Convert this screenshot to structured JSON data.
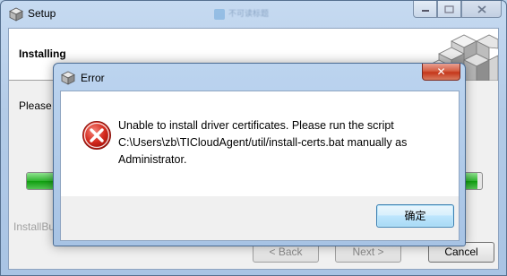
{
  "setup": {
    "title": "Setup",
    "taskbar_tab": "不可读标题",
    "header_title": "Installing",
    "body_text": "Please",
    "progress_fraction": 0.99,
    "brand_text": "InstallBu",
    "back_label": "< Back",
    "next_label": "Next >",
    "cancel_label": "Cancel"
  },
  "error": {
    "title": "Error",
    "close_label": "✕",
    "message_line1": "Unable to install driver certificates. Please run the script",
    "message_line2": "C:\\Users\\zb\\TICloudAgent/util/install-certs.bat manually as",
    "message_line3": "Administrator.",
    "ok_label": "确定"
  },
  "colors": {
    "progress_green": "#2fb42f",
    "error_red": "#c8261d",
    "close_red": "#c5371b"
  },
  "icons": {
    "app": "app-cube-icon",
    "error": "error-x-icon",
    "logo": "setup-cubes-logo"
  }
}
